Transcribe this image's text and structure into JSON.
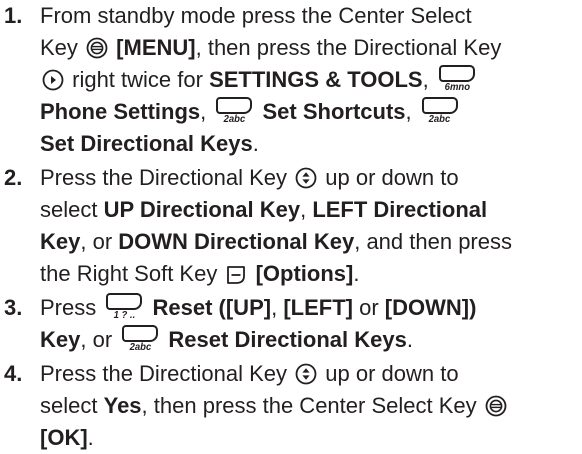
{
  "steps": [
    {
      "number": "1.",
      "lines": {
        "l1": "From standby mode press the Center Select",
        "l2a": "Key",
        "l2b": "[MENU]",
        "l2c": ", then press the Directional Key",
        "l3a": "right twice for",
        "l3b": "SETTINGS & TOOLS",
        "l3c": ",",
        "l4a": "Phone Settings",
        "l4b": ",",
        "l4c": "Set Shortcuts",
        "l4d": ",",
        "l5a": "Set Directional Keys",
        "l5b": "."
      }
    },
    {
      "number": "2.",
      "lines": {
        "l1a": "Press the Directional Key",
        "l1b": "up or down to",
        "l2a": "select",
        "l2b": "UP Directional Key",
        "l2c": ",",
        "l2d": "LEFT Directional",
        "l3a": "Key",
        "l3b": ", or",
        "l3c": "DOWN Directional Key",
        "l3d": ", and then press",
        "l4a": "the Right Soft Key",
        "l4b": "[Options]",
        "l4c": "."
      }
    },
    {
      "number": "3.",
      "lines": {
        "l1a": "Press",
        "l1b": "Reset ([UP]",
        "l1c": ",",
        "l1d": "[LEFT]",
        "l1e": "or",
        "l1f": "[DOWN])",
        "l2a": "Key",
        "l2b": ", or",
        "l2c": "Reset Directional Keys",
        "l2d": "."
      }
    },
    {
      "number": "4.",
      "lines": {
        "l1a": "Press the Directional Key",
        "l1b": "up or down to",
        "l2a": "select",
        "l2b": "Yes",
        "l2c": ", then press the Center Select Key",
        "l3a": "[OK]",
        "l3b": "."
      }
    }
  ],
  "keys": {
    "six": "6mno",
    "two": "2abc",
    "one": "1 ? .."
  },
  "icons": {
    "center_select": "center-select-key-icon",
    "directional_right": "directional-right-icon",
    "directional_updown": "directional-up-down-icon",
    "right_soft_key": "right-soft-key-icon"
  }
}
